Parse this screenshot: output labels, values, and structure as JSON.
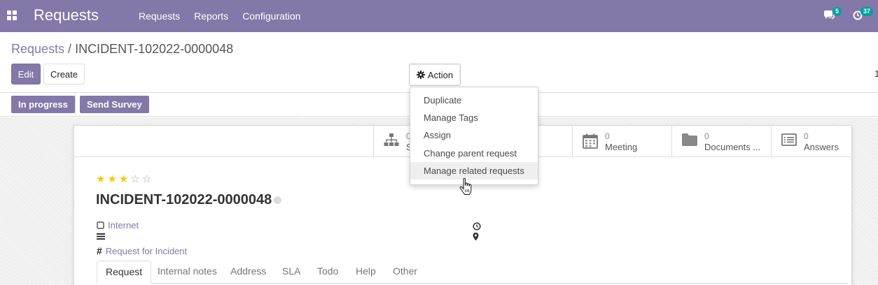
{
  "navbar": {
    "app_title": "Requests",
    "menu": [
      "Requests",
      "Reports",
      "Configuration"
    ],
    "messages_badge": "5",
    "activities_badge": "37"
  },
  "breadcrumb": {
    "parent": "Requests",
    "separator": "/",
    "current": "INCIDENT-102022-0000048"
  },
  "buttons": {
    "edit": "Edit",
    "create": "Create",
    "action": "Action"
  },
  "pager": {
    "fragment": "1"
  },
  "status_buttons": [
    "In progress",
    "Send Survey"
  ],
  "action_menu": [
    "Duplicate",
    "Manage Tags",
    "Assign",
    "Change parent request",
    "Manage related requests"
  ],
  "action_menu_hovered_index": 4,
  "smart_buttons": {
    "first": {
      "count": "0",
      "label": "S"
    },
    "meeting": {
      "count": "0",
      "label": "Meeting"
    },
    "documents": {
      "count": "0",
      "label": "Documents ..."
    },
    "answers": {
      "count": "0",
      "label": "Answers"
    }
  },
  "priority": {
    "filled_stars": 3,
    "total_stars": 5
  },
  "record": {
    "title": "INCIDENT-102022-0000048",
    "category": "Internet",
    "request_type": "Request for Incident"
  },
  "tabs": [
    "Request",
    "Internal notes",
    "Address",
    "SLA",
    "Todo",
    "Help",
    "Other"
  ],
  "colors": {
    "brand": "#8478a9",
    "badge": "#00a09d",
    "star": "#f3cc00"
  }
}
